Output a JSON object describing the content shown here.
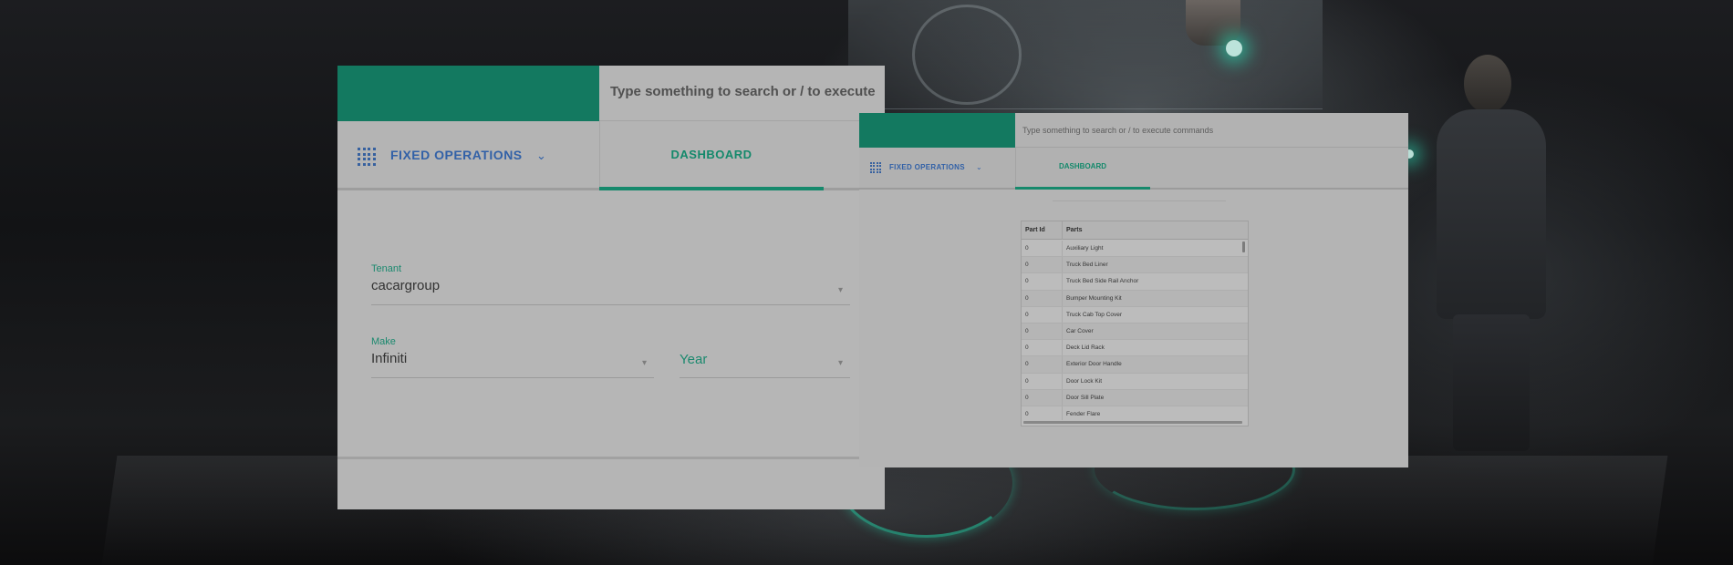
{
  "colors": {
    "brand_green": "#168a6e",
    "accent_teal": "#1a9c7c",
    "module_blue": "#3a6fbf",
    "background": "#0d0e10"
  },
  "main_window": {
    "search": {
      "placeholder": "Type something to search or / to execute"
    },
    "module": {
      "icon": "apps-grid-icon",
      "label": "FIXED OPERATIONS",
      "chevron_icon": "chevron-down-icon"
    },
    "tab": {
      "label": "DASHBOARD"
    },
    "form": {
      "tenant": {
        "label": "Tenant",
        "value": "cacargroup"
      },
      "make": {
        "label": "Make",
        "value": "Infiniti"
      },
      "year": {
        "placeholder": "Year"
      }
    }
  },
  "secondary_window": {
    "search": {
      "placeholder": "Type something to search or / to execute commands"
    },
    "module": {
      "icon": "apps-grid-icon",
      "label": "FIXED OPERATIONS",
      "chevron_icon": "chevron-down-icon"
    },
    "tab": {
      "label": "DASHBOARD"
    },
    "table": {
      "columns": [
        "Part Id",
        "Parts"
      ],
      "rows": [
        [
          "0",
          "Auxiliary Light"
        ],
        [
          "0",
          "Truck Bed Liner"
        ],
        [
          "0",
          "Truck Bed Side Rail Anchor"
        ],
        [
          "0",
          "Bumper Mounting Kit"
        ],
        [
          "0",
          "Truck Cab Top Cover"
        ],
        [
          "0",
          "Car Cover"
        ],
        [
          "0",
          "Deck Lid Rack"
        ],
        [
          "0",
          "Exterior Door Handle"
        ],
        [
          "0",
          "Door Lock Kit"
        ],
        [
          "0",
          "Door Sill Plate"
        ],
        [
          "0",
          "Fender Flare"
        ]
      ]
    }
  }
}
